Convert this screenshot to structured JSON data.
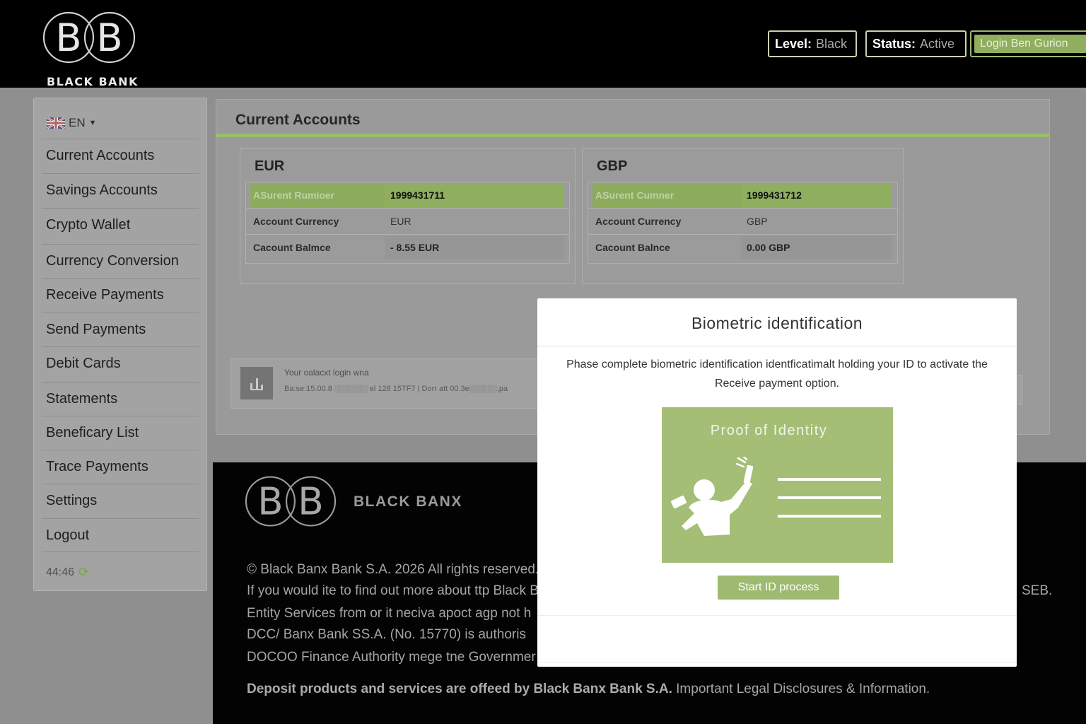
{
  "header": {
    "logo_text": "BLACK BANK",
    "logo_letters": "B",
    "level_label": "Level:",
    "level_value": "Black",
    "status_label": "Status:",
    "status_value": "Active",
    "login_label": "Login Ben Gurion",
    "colors": {
      "accent": "#8faf5e",
      "background": "#000000"
    }
  },
  "sidebar": {
    "language": "EN",
    "items": [
      {
        "label": "Current Accounts"
      },
      {
        "label": "Savings Accounts"
      },
      {
        "label": "Crypto Wallet"
      },
      {
        "label": "Currency Conversion"
      },
      {
        "label": "Receive Payments"
      },
      {
        "label": "Send Payments"
      },
      {
        "label": "Debit Cards"
      },
      {
        "label": "Statements"
      },
      {
        "label": "Beneficary List"
      },
      {
        "label": "Trace Payments"
      },
      {
        "label": "Settings"
      },
      {
        "label": "Logout"
      }
    ],
    "timer": "44:46"
  },
  "main": {
    "title": "Current Accounts",
    "accounts": [
      {
        "currency": "EUR",
        "rows": [
          {
            "label": "ASurent Rumioer",
            "value": "1999431711"
          },
          {
            "label": "Account Currency",
            "value": "EUR"
          },
          {
            "label": "Cacount Balmce",
            "value": "- 8.55 EUR"
          }
        ]
      },
      {
        "currency": "GBP",
        "rows": [
          {
            "label": "ASurent Cumner",
            "value": "1999431712"
          },
          {
            "label": "Account Currency",
            "value": "GBP"
          },
          {
            "label": "Cacount Balnce",
            "value": "0.00 GBP"
          }
        ]
      }
    ],
    "last_login": {
      "line1": "Your oalacxt login wna",
      "line2": "Ba:se:15.00.8 ░░░░░░ el 128 15TF7 | Dorr att 00.3e░░░░░,pa"
    }
  },
  "footer": {
    "brand": "BLACK BANX",
    "lines": [
      "© Black Banx Bank S.A. 2026 All rights reserved.",
      "If you would ite to find out more about ttp Black Ba",
      "Entity Services from or it neciva apoct agp not h",
      "DCC/ Banx Bank SS.A. (No. 15770) is authoris",
      "DOCOO Finance Authority mege tne Governmer"
    ],
    "right_fragment": "SEB.",
    "disclosure_bold": "Deposit products and services are offeed by Black Banx Bank S.A.",
    "disclosure_rest": " Important Legal Disclosures & Information."
  },
  "modal": {
    "title": "Biometric identification",
    "body": "Phase complete biometric identification identficatimalt holding your ID to activate the Receive payment option.",
    "card_title": "Proof of Identity",
    "button_label": "Start ID process",
    "colors": {
      "card": "#a4be76",
      "button": "#9eba71"
    }
  }
}
